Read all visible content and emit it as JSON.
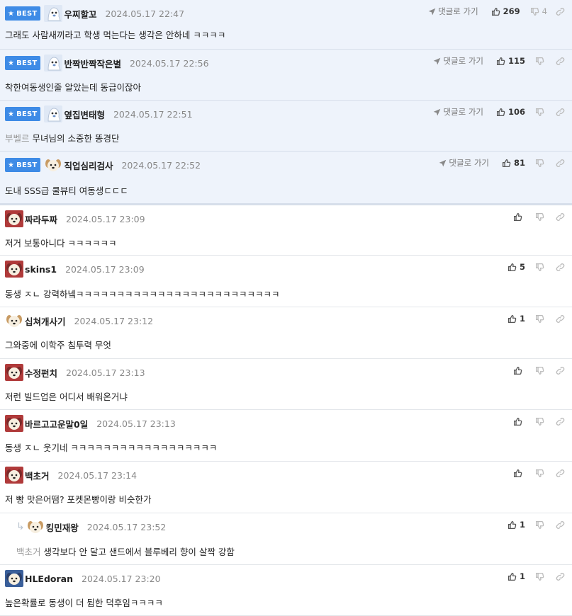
{
  "best_label": "BEST",
  "goto_label": "댓글로 가기",
  "comments": [
    {
      "best": true,
      "avatar": "avatar-ghost",
      "nick": "우찌할꼬",
      "date": "2024.05.17 22:47",
      "ref": "",
      "text": "그래도 사람새끼라고 학생 먹는다는 생각은 안하네 ㅋㅋㅋㅋ",
      "up": "269",
      "down": "4"
    },
    {
      "best": true,
      "avatar": "avatar-ghost",
      "nick": "반짝반짝작은별",
      "date": "2024.05.17 22:56",
      "ref": "",
      "text": "착한여동생인줄 알았는데 동급이잖아",
      "up": "115",
      "down": ""
    },
    {
      "best": true,
      "avatar": "avatar-ghost",
      "nick": "옆집변태형",
      "date": "2024.05.17 22:51",
      "ref": "부벨르",
      "text": "무녀님의 소중한 똥경단",
      "up": "106",
      "down": ""
    },
    {
      "best": true,
      "avatar": "avatar-dog",
      "nick": "직업심리검사",
      "date": "2024.05.17 22:52",
      "ref": "",
      "text": "도내 SSS급 쿨뷰티 여동생ㄷㄷㄷ",
      "up": "81",
      "down": ""
    },
    {
      "best": false,
      "avatar": "avatar-dog-red",
      "nick": "짜라두짜",
      "date": "2024.05.17 23:09",
      "ref": "",
      "text": "저거 보통아니다 ㅋㅋㅋㅋㅋㅋ",
      "up": "",
      "down": ""
    },
    {
      "best": false,
      "avatar": "avatar-dog-red",
      "nick": "skins1",
      "date": "2024.05.17 23:09",
      "ref": "",
      "text": "동생 ㅈㄴ 강력하넼ㅋㅋㅋㅋㅋㅋㅋㅋㅋㅋㅋㅋㅋㅋㅋㅋㅋㅋㅋㅋㅋㅋㅋㅋㅋ",
      "up": "5",
      "down": ""
    },
    {
      "best": false,
      "avatar": "avatar-dog",
      "nick": "십쳐개사기",
      "date": "2024.05.17 23:12",
      "ref": "",
      "text": "그와중에 이학주 침투력 무엇",
      "up": "1",
      "down": ""
    },
    {
      "best": false,
      "avatar": "avatar-dog-red",
      "nick": "수정펀치",
      "date": "2024.05.17 23:13",
      "ref": "",
      "text": "저런 빌드업은 어디서 배워온거냐",
      "up": "",
      "down": ""
    },
    {
      "best": false,
      "avatar": "avatar-dog-red",
      "nick": "바르고고운말0일",
      "date": "2024.05.17 23:13",
      "ref": "",
      "text": "동생 ㅈㄴ 웃기네 ㅋㅋㅋㅋㅋㅋㅋㅋㅋㅋㅋㅋㅋㅋㅋㅋㅋㅋ",
      "up": "",
      "down": ""
    },
    {
      "best": false,
      "avatar": "avatar-dog-red",
      "nick": "백초거",
      "date": "2024.05.17 23:14",
      "ref": "",
      "text": "저 빵 맛은어떰? 포켓몬빵이랑 비슷한가",
      "up": "",
      "down": ""
    },
    {
      "best": false,
      "reply": true,
      "avatar": "avatar-dog",
      "nick": "킹민재왕",
      "date": "2024.05.17 23:52",
      "ref": "백초거",
      "text": "생각보다 안 달고 샌드에서 블루베리 향이 살짝 강함",
      "up": "1",
      "down": ""
    },
    {
      "best": false,
      "avatar": "avatar-dog-blue",
      "nick": "HLEdoran",
      "date": "2024.05.17 23:20",
      "ref": "",
      "text": "높은확률로 동생이 더 뒴한 덕후임ㅋㅋㅋㅋ",
      "up": "1",
      "down": ""
    }
  ]
}
